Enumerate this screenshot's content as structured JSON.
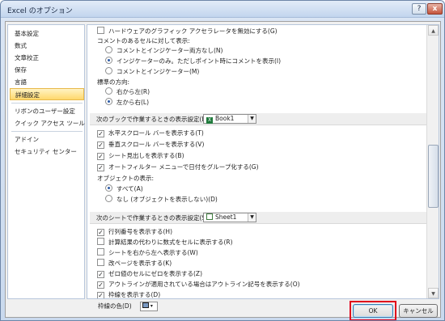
{
  "window": {
    "title": "Excel のオプション",
    "help_label": "?",
    "close_label": "x"
  },
  "sidebar": {
    "items": [
      {
        "label": "基本設定"
      },
      {
        "label": "数式"
      },
      {
        "label": "文章校正"
      },
      {
        "label": "保存"
      },
      {
        "label": "言語"
      },
      {
        "label": "詳細設定",
        "selected": true
      },
      {
        "label": "リボンのユーザー設定"
      },
      {
        "label": "クイック アクセス ツール バー"
      },
      {
        "label": "アドイン"
      },
      {
        "label": "セキュリティ センター"
      }
    ]
  },
  "content": {
    "hw_accel": "ハードウェアのグラフィック アクセラレータを無効にする(G)",
    "comment_header": "コメントのあるセルに対して表示:",
    "comment_opt1": "コメントとインジケーター両方なし(N)",
    "comment_opt2": "インジケーターのみ。ただしポイント時にコメントを表示(I)",
    "comment_opt3": "コメントとインジケーター(M)",
    "direction_header": "標準の方向:",
    "direction_opt1": "右から左(R)",
    "direction_opt2": "左から右(L)",
    "book_section": "次のブックで作業するときの表示設定(B):",
    "book_value": "Book1",
    "book_opts": [
      "水平スクロール バーを表示する(T)",
      "垂直スクロール バーを表示する(V)",
      "シート見出しを表示する(B)",
      "オートフィルター メニューで日付をグループ化する(G)"
    ],
    "objects_header": "オブジェクトの表示:",
    "objects_opt1": "すべて(A)",
    "objects_opt2": "なし (オブジェクトを表示しない)(D)",
    "sheet_section": "次のシートで作業するときの表示設定(S):",
    "sheet_value": "Sheet1",
    "sheet_opts": [
      "行列番号を表示する(H)",
      "計算結果の代わりに数式をセルに表示する(R)",
      "シートを右から左へ表示する(W)",
      "改ページを表示する(K)",
      "ゼロ値のセルにゼロを表示する(Z)",
      "アウトラインが適用されている場合はアウトライン記号を表示する(O)",
      "枠線を表示する(D)"
    ],
    "gridline_color": "枠線の色(D)",
    "check_mark": "✓"
  },
  "buttons": {
    "ok": "OK",
    "cancel": "キャンセル"
  },
  "colors": {
    "highlight": "#e0001b",
    "selected_bg": "#ffd86c"
  }
}
